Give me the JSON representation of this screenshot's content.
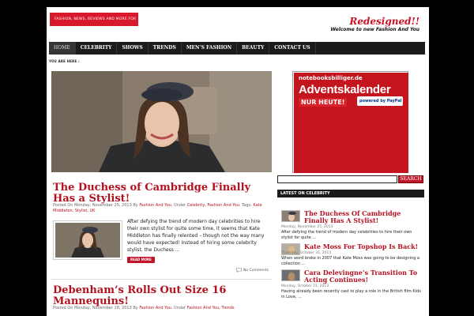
{
  "header": {
    "tagline": "FASHION, NEWS, REVIEWS AND MORE FOR YOU",
    "redesigned": "Redesigned!!",
    "welcome": "Welcome to new Fashion And You"
  },
  "nav": {
    "items": [
      "HOME",
      "CELEBRITY",
      "SHOWS",
      "TRENDS",
      "MEN’S FASHION",
      "BEAUTY",
      "CONTACT US"
    ]
  },
  "breadcrumb": "YOU ARE HERE :",
  "posts": [
    {
      "title": "The Duchess of Cambridge Finally Has a Stylist!",
      "meta_prefix": "Posted On Monday, November 25, 2013 By ",
      "author": "Fashion And You",
      "meta_under": ". Under ",
      "categories": "Celebrity, Fashion And You",
      "meta_tags": ". Tags: ",
      "tags": "Kate Middleton, Stylist, UK",
      "excerpt": "After defying the trend of modern day celebrities to hire their own stylist for quite some time, it seems that Kate Middleton has finally relented – though not the way many would have expected! Instead of hiring some celebrity stylist, the Duchess ...",
      "read_more": "READ MORE",
      "comments": "No Comments"
    },
    {
      "title": "Debenham’s Rolls Out Size 16 Mannequins!",
      "meta_prefix": "Posted On Monday, November 18, 2013 By ",
      "author": "Fashion And You",
      "meta_under": ". Under ",
      "categories": "Fashion And You, Trends"
    }
  ],
  "ad": {
    "brand": "notebooksbilliger.de",
    "headline": "Adventskalender",
    "badge": "NUR HEUTE!",
    "paypal": "powered by PayPal"
  },
  "search": {
    "placeholder": "",
    "button": "SEARCH"
  },
  "sidebar": {
    "header": "LATEST ON CELEBRITY",
    "items": [
      {
        "title": "The Duchess Of Cambridge Finally Has A Stylist!",
        "date": "Monday, November 25, 2013",
        "text": "After defying the trend of modern day celebrities to hire their own stylist for quite ..."
      },
      {
        "title": "Kate Moss For Topshop Is Back!",
        "date": "Thursday, October 31, 2013",
        "text": "When word broke in 2007 that Kate Moss was going to be designing a collection ..."
      },
      {
        "title": "Cara Delevingne’s Transition To Acting Continues!",
        "date": "Monday, October 21, 2013",
        "text": "Having already been recently cast to play a role in the British film Kids in Love, ..."
      }
    ]
  },
  "colors": {
    "accent": "#c0152a",
    "nav_bg": "#1b1b1b",
    "link": "#b3111f"
  }
}
